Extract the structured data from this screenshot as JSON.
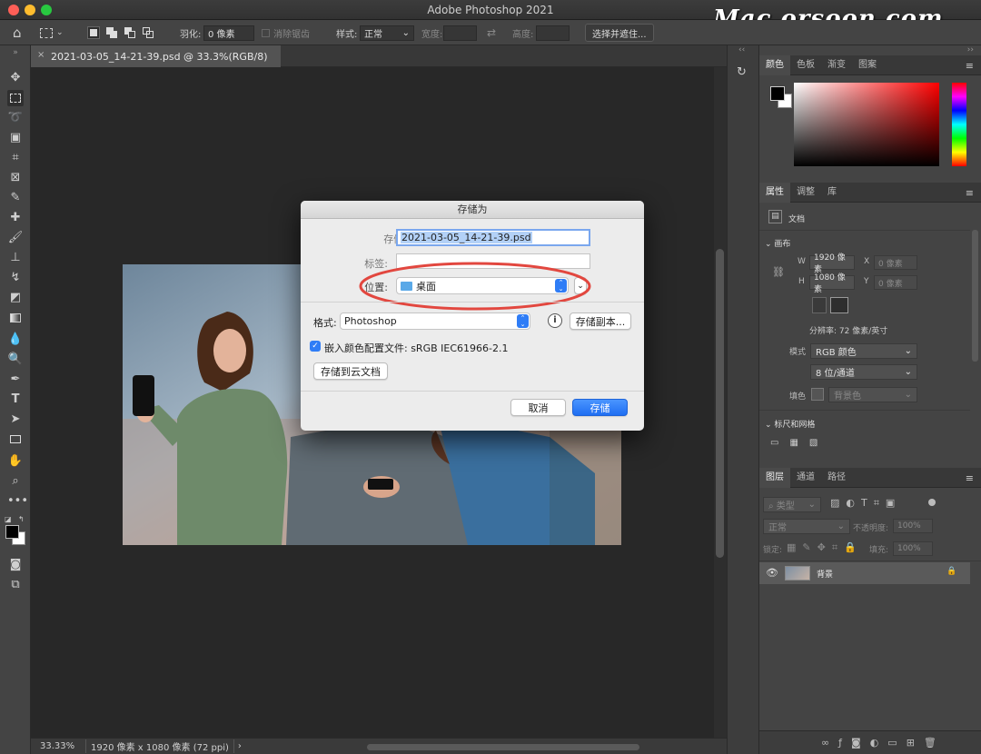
{
  "app": {
    "title": "Adobe Photoshop 2021",
    "watermark": "Mac.orsoon.com",
    "traffic_lights": {
      "close": "#fe5f57",
      "minimize": "#febc2e",
      "zoom": "#28c840"
    }
  },
  "options_bar": {
    "feather_label": "羽化:",
    "feather_value": "0 像素",
    "antialias_label": "消除锯齿",
    "style_label": "样式:",
    "style_value": "正常",
    "width_label": "宽度:",
    "height_label": "高度:",
    "select_mask_button": "选择并遮住..."
  },
  "document": {
    "tab_title": "2021-03-05_14-21-39.psd @ 33.3%(RGB/8)",
    "zoom": "33.33%",
    "dimensions": "1920 像素 x 1080 像素 (72 ppi)"
  },
  "save_dialog": {
    "title": "存储为",
    "save_as_label": "存储为:",
    "filename": "2021-03-05_14-21-39.psd",
    "tags_label": "标签:",
    "location_label": "位置:",
    "location_value": "桌面",
    "format_label": "格式:",
    "format_value": "Photoshop",
    "save_copy_button": "存储副本...",
    "embed_profile_label": "嵌入颜色配置文件: sRGB IEC61966-2.1",
    "embed_profile_checked": true,
    "save_cloud_button": "存储到云文档",
    "cancel_button": "取消",
    "save_button": "存储",
    "highlight_color": "#e2473f",
    "accent_color": "#2f7df6"
  },
  "color_panel": {
    "tabs": [
      "颜色",
      "色板",
      "渐变",
      "图案"
    ],
    "active_tab": 0,
    "base_hue": "#ff0000"
  },
  "properties_panel": {
    "tabs": [
      "属性",
      "调整",
      "库"
    ],
    "active_tab": 0,
    "document_label": "文档",
    "canvas_section": "画布",
    "w_label": "W",
    "w_value": "1920 像素",
    "h_label": "H",
    "h_value": "1080 像素",
    "x_label": "X",
    "x_placeholder": "0 像素",
    "y_label": "Y",
    "y_placeholder": "0 像素",
    "resolution": "分辨率: 72 像素/英寸",
    "mode_label": "模式",
    "mode_value": "RGB 颜色",
    "bit_depth": "8 位/通道",
    "fill_label": "填色",
    "fill_value": "背景色",
    "rulers_section": "标尺和网格"
  },
  "layers_panel": {
    "tabs": [
      "图层",
      "通道",
      "路径"
    ],
    "active_tab": 0,
    "filter_label": "类型",
    "blend_mode": "正常",
    "opacity_label": "不透明度:",
    "opacity_value": "100%",
    "lock_label": "锁定:",
    "fill_label": "填充:",
    "fill_value": "100%",
    "layers": [
      {
        "name": "背景",
        "visible": true,
        "locked": true
      }
    ]
  }
}
